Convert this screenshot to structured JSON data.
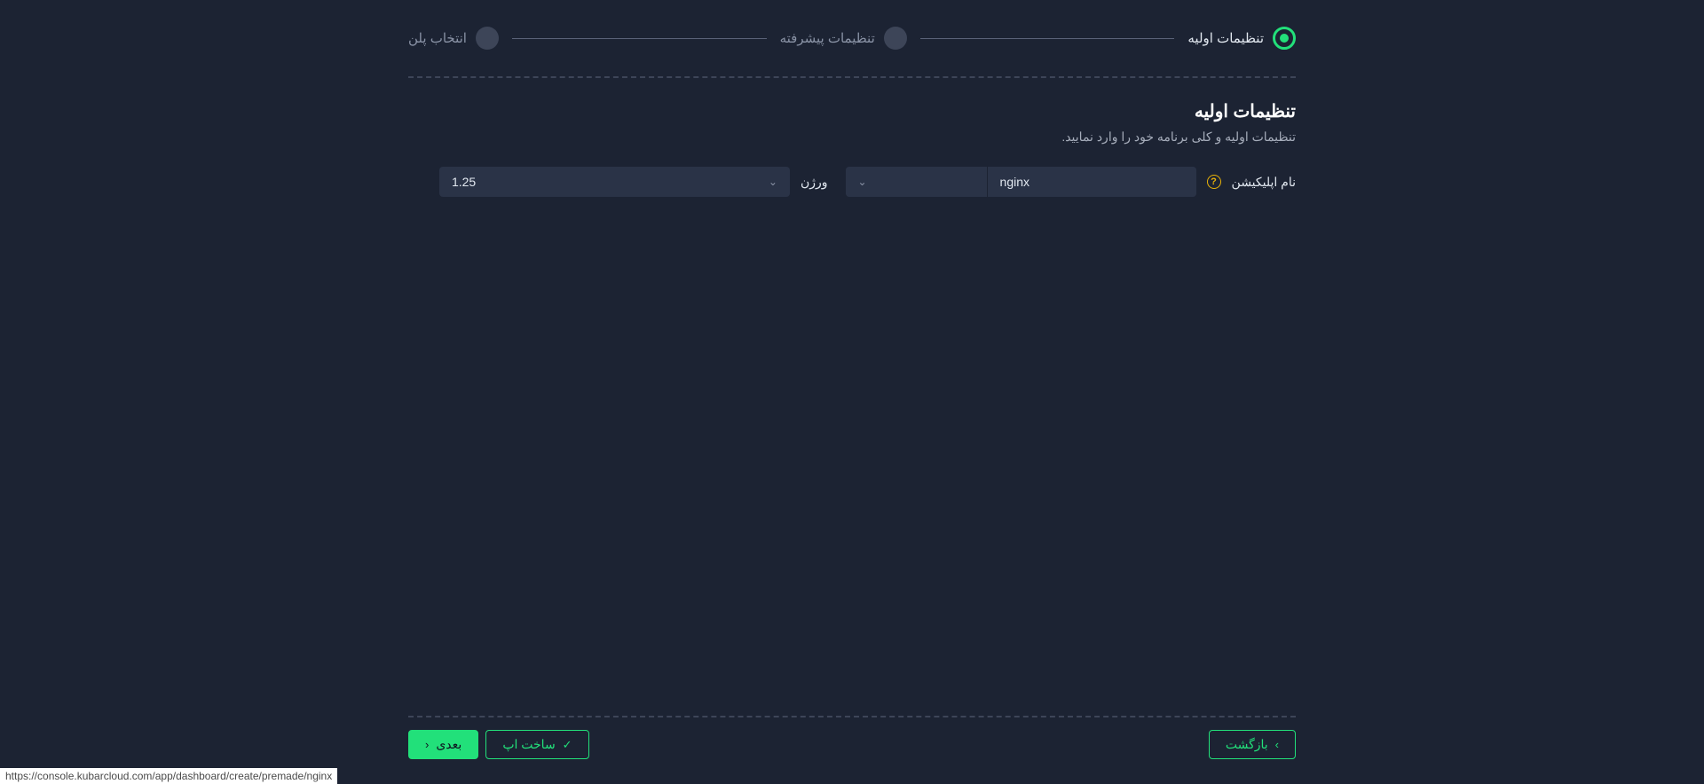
{
  "stepper": {
    "steps": [
      {
        "label": "تنظیمات اولیه",
        "active": true
      },
      {
        "label": "تنظیمات پیشرفته",
        "active": false
      },
      {
        "label": "انتخاب پلن",
        "active": false
      }
    ]
  },
  "section": {
    "title": "تنظیمات اولیه",
    "subtitle": "تنظیمات اولیه و کلی برنامه خود را وارد نمایید."
  },
  "form": {
    "appNameLabel": "نام اپلیکیشن",
    "appNameValue": "nginx",
    "appNameSelectValue": "",
    "versionLabel": "ورژن",
    "versionValue": "1.25"
  },
  "buttons": {
    "back": "بازگشت",
    "createApp": "ساخت اپ",
    "next": "بعدی"
  },
  "statusUrl": "https://console.kubarcloud.com/app/dashboard/create/premade/nginx"
}
